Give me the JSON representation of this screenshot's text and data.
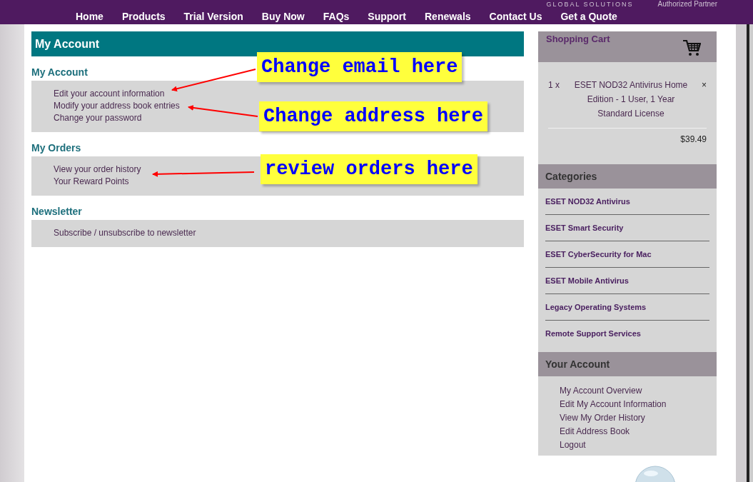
{
  "header": {
    "brand_tagline": "GLOBAL SOLUTIONS",
    "partner": "Authorized Partner"
  },
  "nav": [
    "Home",
    "Products",
    "Trial Version",
    "Buy Now",
    "FAQs",
    "Support",
    "Renewals",
    "Contact Us",
    "Get a Quote"
  ],
  "main": {
    "title": "My Account",
    "sections": [
      {
        "heading": "My Account",
        "links": [
          "Edit your account information",
          "Modify your address book entries",
          "Change your password"
        ]
      },
      {
        "heading": "My Orders",
        "links": [
          "View your order history",
          "Your Reward Points"
        ]
      },
      {
        "heading": "Newsletter",
        "links": [
          "Subscribe / unsubscribe to newsletter"
        ]
      }
    ]
  },
  "annotations": [
    {
      "text": "Change email here"
    },
    {
      "text": "Change address here"
    },
    {
      "text": "review orders here"
    }
  ],
  "cart": {
    "title": "Shopping Cart",
    "items": [
      {
        "quantity": "1 x",
        "name": "ESET NOD32 Antivirus Home Edition - 1 User, 1 Year Standard License",
        "remove": "×"
      }
    ],
    "total": "$39.49"
  },
  "categories": {
    "title": "Categories",
    "items": [
      "ESET NOD32 Antivirus",
      "ESET Smart Security",
      "ESET CyberSecurity for Mac",
      "ESET Mobile Antivirus",
      "Legacy Operating Systems",
      "Remote Support Services"
    ]
  },
  "your_account": {
    "title": "Your Account",
    "links": [
      "My Account Overview",
      "Edit My Account Information",
      "View My Order History",
      "Edit Address Book",
      "Logout"
    ]
  }
}
